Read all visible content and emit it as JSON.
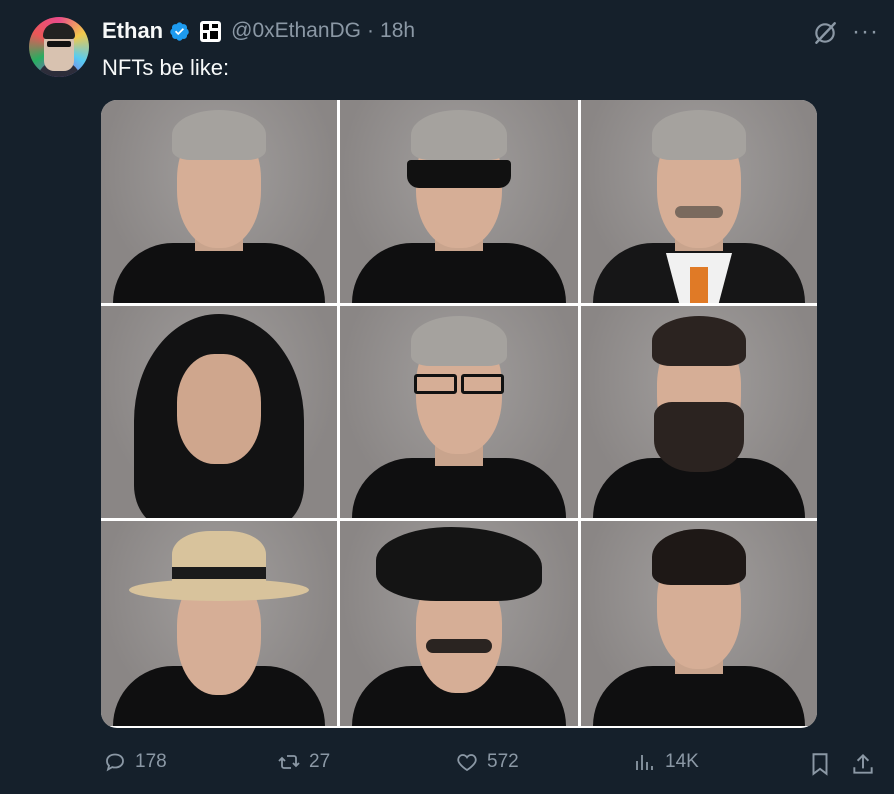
{
  "tweet": {
    "author_name": "Ethan",
    "handle": "@0xEthanDG",
    "separator": "·",
    "time": "18h",
    "text": "NFTs be like:"
  },
  "media": {
    "cells": [
      {
        "variant": "plain"
      },
      {
        "variant": "sunglasses"
      },
      {
        "variant": "suit-orange-tie"
      },
      {
        "variant": "hood"
      },
      {
        "variant": "glasses"
      },
      {
        "variant": "dark-beard"
      },
      {
        "variant": "straw-hat"
      },
      {
        "variant": "beret-mustache"
      },
      {
        "variant": "dark-hair"
      }
    ]
  },
  "actions": {
    "replies": "178",
    "retweets": "27",
    "likes": "572",
    "views": "14K"
  },
  "colors": {
    "background": "#15202b",
    "muted_text": "#8b98a5",
    "verified": "#1d9bf0"
  },
  "icons": [
    "verified-badge-icon",
    "affiliate-badge-icon",
    "grok-icon",
    "more-icon",
    "reply-icon",
    "retweet-icon",
    "like-icon",
    "views-icon",
    "bookmark-icon",
    "share-icon"
  ]
}
